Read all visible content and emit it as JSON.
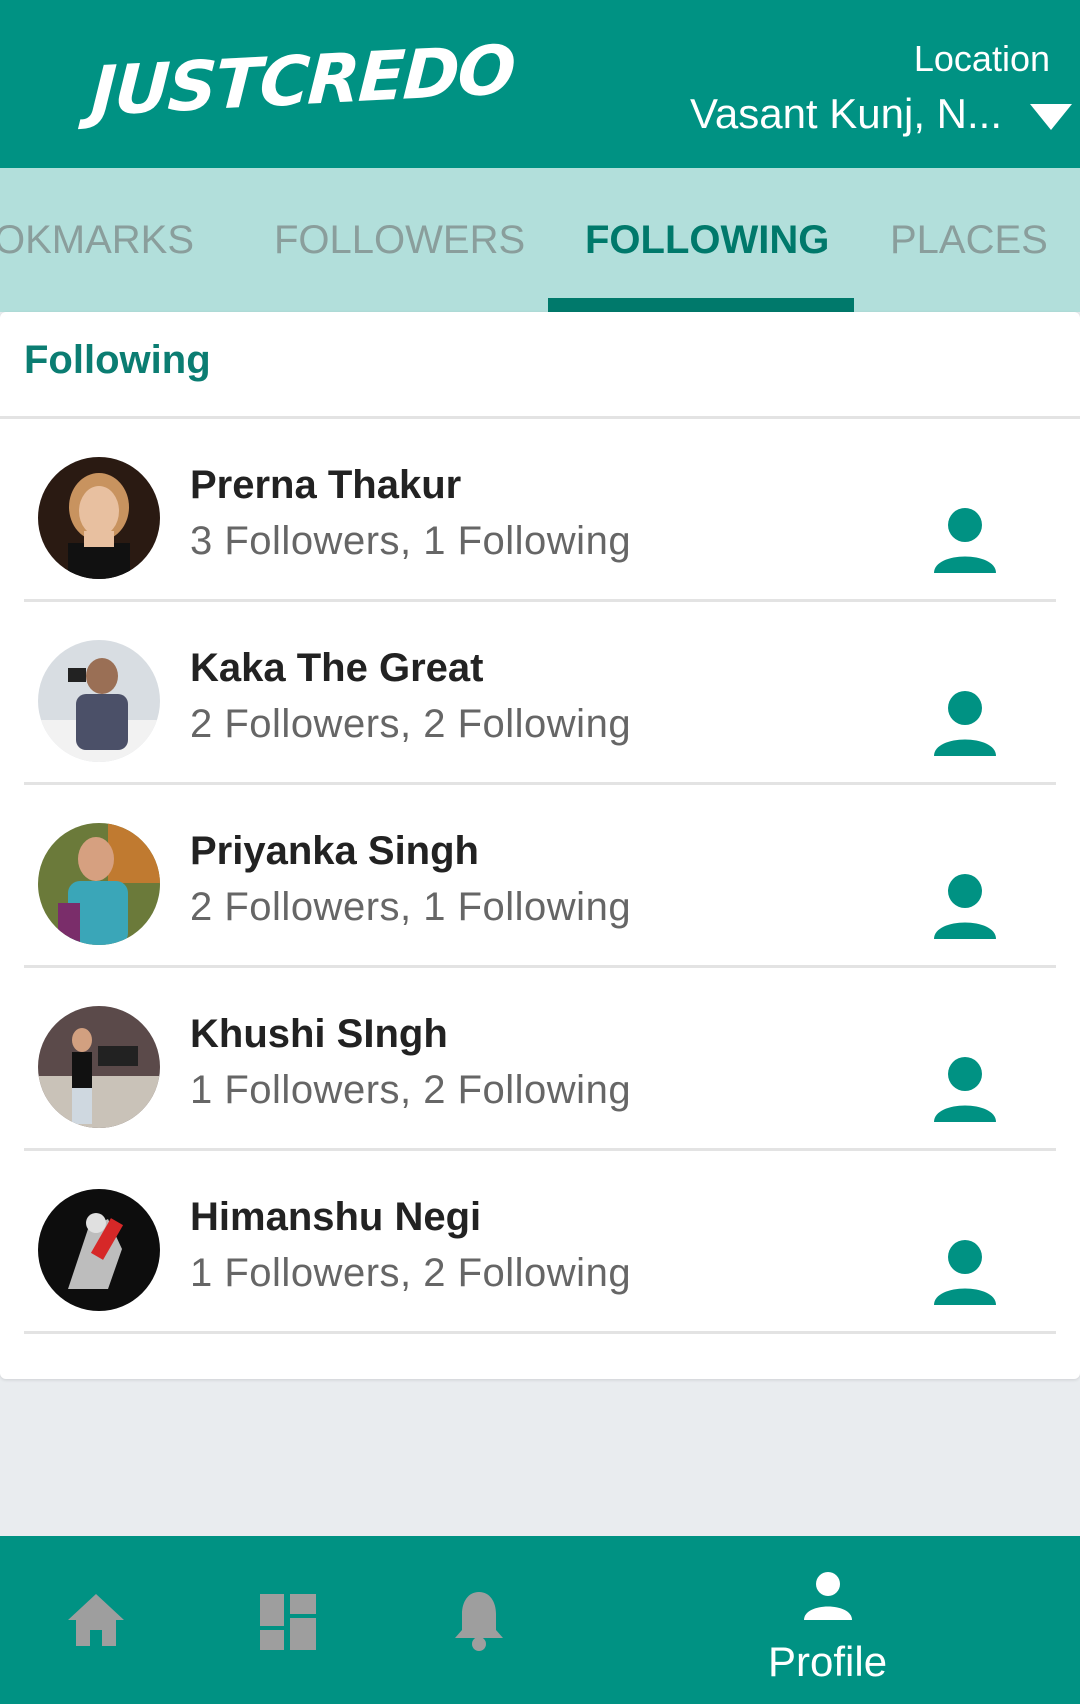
{
  "header": {
    "logo_text": "JUSTCREDO",
    "location_label": "Location",
    "location_value": "Vasant Kunj, N..."
  },
  "tabs": [
    {
      "label": "OKMARKS",
      "active": false
    },
    {
      "label": "FOLLOWERS",
      "active": false
    },
    {
      "label": "FOLLOWING",
      "active": true
    },
    {
      "label": "PLACES",
      "active": false
    }
  ],
  "section": {
    "title": "Following"
  },
  "people": [
    {
      "name": "Prerna Thakur",
      "stats": "3 Followers, 1 Following"
    },
    {
      "name": "Kaka The Great",
      "stats": "2 Followers, 2 Following"
    },
    {
      "name": "Priyanka Singh",
      "stats": "2 Followers, 1 Following"
    },
    {
      "name": "Khushi SIngh",
      "stats": "1 Followers, 2 Following"
    },
    {
      "name": "Himanshu Negi",
      "stats": "1 Followers, 2 Following"
    }
  ],
  "bottom_nav": {
    "items": [
      {
        "icon": "home-icon"
      },
      {
        "icon": "dashboard-icon"
      },
      {
        "icon": "bell-icon"
      },
      {
        "icon": "profile-icon",
        "label": "Profile",
        "active": true
      }
    ]
  },
  "colors": {
    "primary": "#009283",
    "primary_dark": "#00796b",
    "tab_bar_bg": "#b2dfdb",
    "inactive_tab": "#8a9e9c",
    "icon_inactive": "#9e9e9e"
  }
}
